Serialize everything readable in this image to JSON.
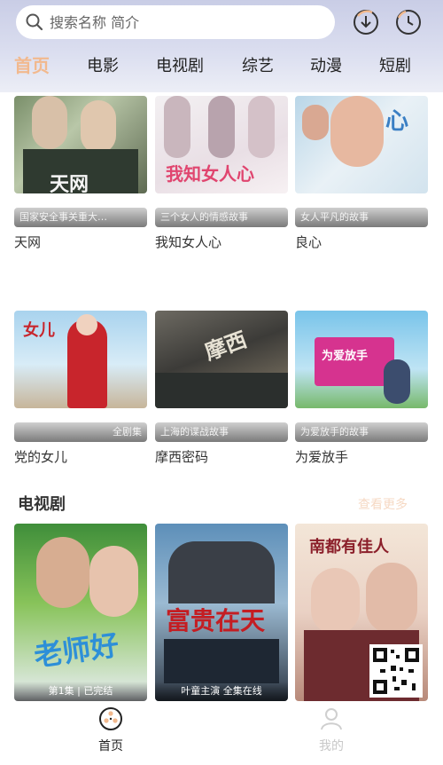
{
  "search": {
    "placeholder": "搜索名称 简介"
  },
  "header_icons": [
    "download-icon",
    "history-icon"
  ],
  "tabs": [
    {
      "label": "首页",
      "active": true
    },
    {
      "label": "电影",
      "active": false
    },
    {
      "label": "电视剧",
      "active": false
    },
    {
      "label": "综艺",
      "active": false
    },
    {
      "label": "动漫",
      "active": false
    },
    {
      "label": "短剧",
      "active": false
    }
  ],
  "row1": [
    {
      "caption": "国家安全事关重大…",
      "title": "天网"
    },
    {
      "caption": "三个女人的情感故事",
      "title": "我知女人心"
    },
    {
      "caption": "女人平凡的故事",
      "title": "良心"
    }
  ],
  "row2": [
    {
      "caption": "全剧集",
      "title": "党的女儿"
    },
    {
      "caption": "上海的谍战故事",
      "title": "摩西密码"
    },
    {
      "caption": "为爱放手的故事",
      "title": "为爱放手"
    }
  ],
  "section": {
    "title": "电视剧",
    "more": "查看更多"
  },
  "tv": [
    {
      "poster_text": "老师好",
      "caption": "第1集 | 已完结"
    },
    {
      "poster_text": "富贵在天",
      "caption": "叶童主演 全集在线"
    },
    {
      "poster_text": "南都有佳人",
      "caption": ""
    }
  ],
  "bottom_nav": [
    {
      "label": "首页",
      "active": true
    },
    {
      "label": "我的",
      "active": false
    }
  ],
  "colors": {
    "accent": "#f2b98e",
    "header_bg": "#d3d6ec"
  }
}
